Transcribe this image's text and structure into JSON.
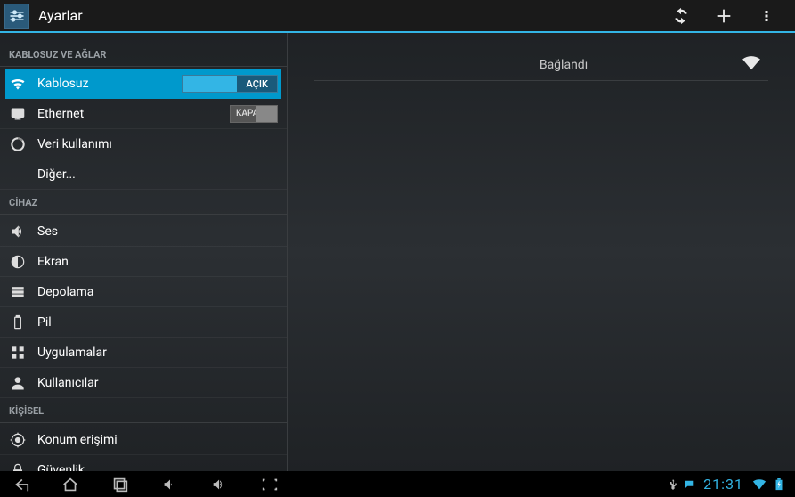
{
  "app_title": "Ayarlar",
  "topbar": {
    "refresh": "refresh",
    "add": "add",
    "overflow": "overflow"
  },
  "sidebar": {
    "sections": [
      {
        "header": "KABLOSUZ VE AĞLAR",
        "items": [
          {
            "id": "wifi",
            "label": "Kablosuz",
            "toggle": "AÇIK",
            "selected": true
          },
          {
            "id": "ethernet",
            "label": "Ethernet",
            "toggle": "KAPALI"
          },
          {
            "id": "data-usage",
            "label": "Veri kullanımı"
          },
          {
            "id": "more",
            "label": "Diğer...",
            "indent": true
          }
        ]
      },
      {
        "header": "CİHAZ",
        "items": [
          {
            "id": "sound",
            "label": "Ses"
          },
          {
            "id": "display",
            "label": "Ekran"
          },
          {
            "id": "storage",
            "label": "Depolama"
          },
          {
            "id": "battery",
            "label": "Pil"
          },
          {
            "id": "apps",
            "label": "Uygulamalar"
          },
          {
            "id": "users",
            "label": "Kullanıcılar"
          }
        ]
      },
      {
        "header": "KİŞİSEL",
        "items": [
          {
            "id": "location",
            "label": "Konum erişimi"
          },
          {
            "id": "security",
            "label": "Güvenlik"
          }
        ]
      }
    ]
  },
  "detail": {
    "connected_label": "Bağlandı"
  },
  "statusbar": {
    "clock": "21:31"
  }
}
